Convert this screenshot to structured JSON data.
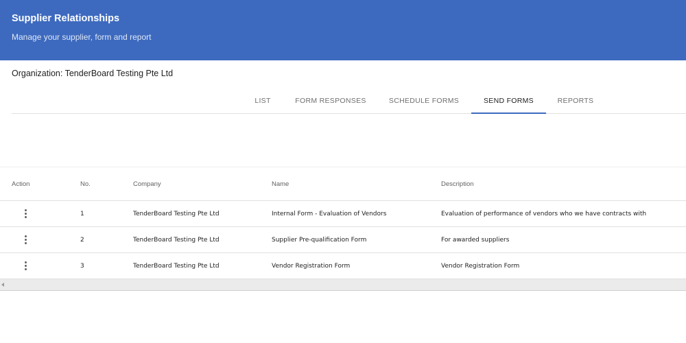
{
  "header": {
    "title": "Supplier Relationships",
    "subtitle": "Manage your supplier, form and report",
    "background": "#3d6abf"
  },
  "organization": {
    "label": "Organization: TenderBoard Testing Pte Ltd"
  },
  "tabs": [
    {
      "label": "LIST",
      "active": false
    },
    {
      "label": "FORM RESPONSES",
      "active": false
    },
    {
      "label": "SCHEDULE FORMS",
      "active": false
    },
    {
      "label": "SEND FORMS",
      "active": true
    },
    {
      "label": "REPORTS",
      "active": false
    }
  ],
  "table": {
    "headers": {
      "action": "Action",
      "no": "No.",
      "company": "Company",
      "name": "Name",
      "description": "Description"
    },
    "rows": [
      {
        "action_icon": "more-vert-icon",
        "no": "1",
        "company": "TenderBoard Testing Pte Ltd",
        "name": "Internal Form - Evaluation of Vendors",
        "description": "Evaluation of performance of vendors who we have contracts with"
      },
      {
        "action_icon": "more-vert-icon",
        "no": "2",
        "company": "TenderBoard Testing Pte Ltd",
        "name": "Supplier Pre-qualification Form",
        "description": "For awarded suppliers"
      },
      {
        "action_icon": "more-vert-icon",
        "no": "3",
        "company": "TenderBoard Testing Pte Ltd",
        "name": "Vendor Registration Form",
        "description": "Vendor Registration Form"
      }
    ]
  },
  "scrollbar": {
    "left_arrow_icon": "chevron-left-icon"
  }
}
